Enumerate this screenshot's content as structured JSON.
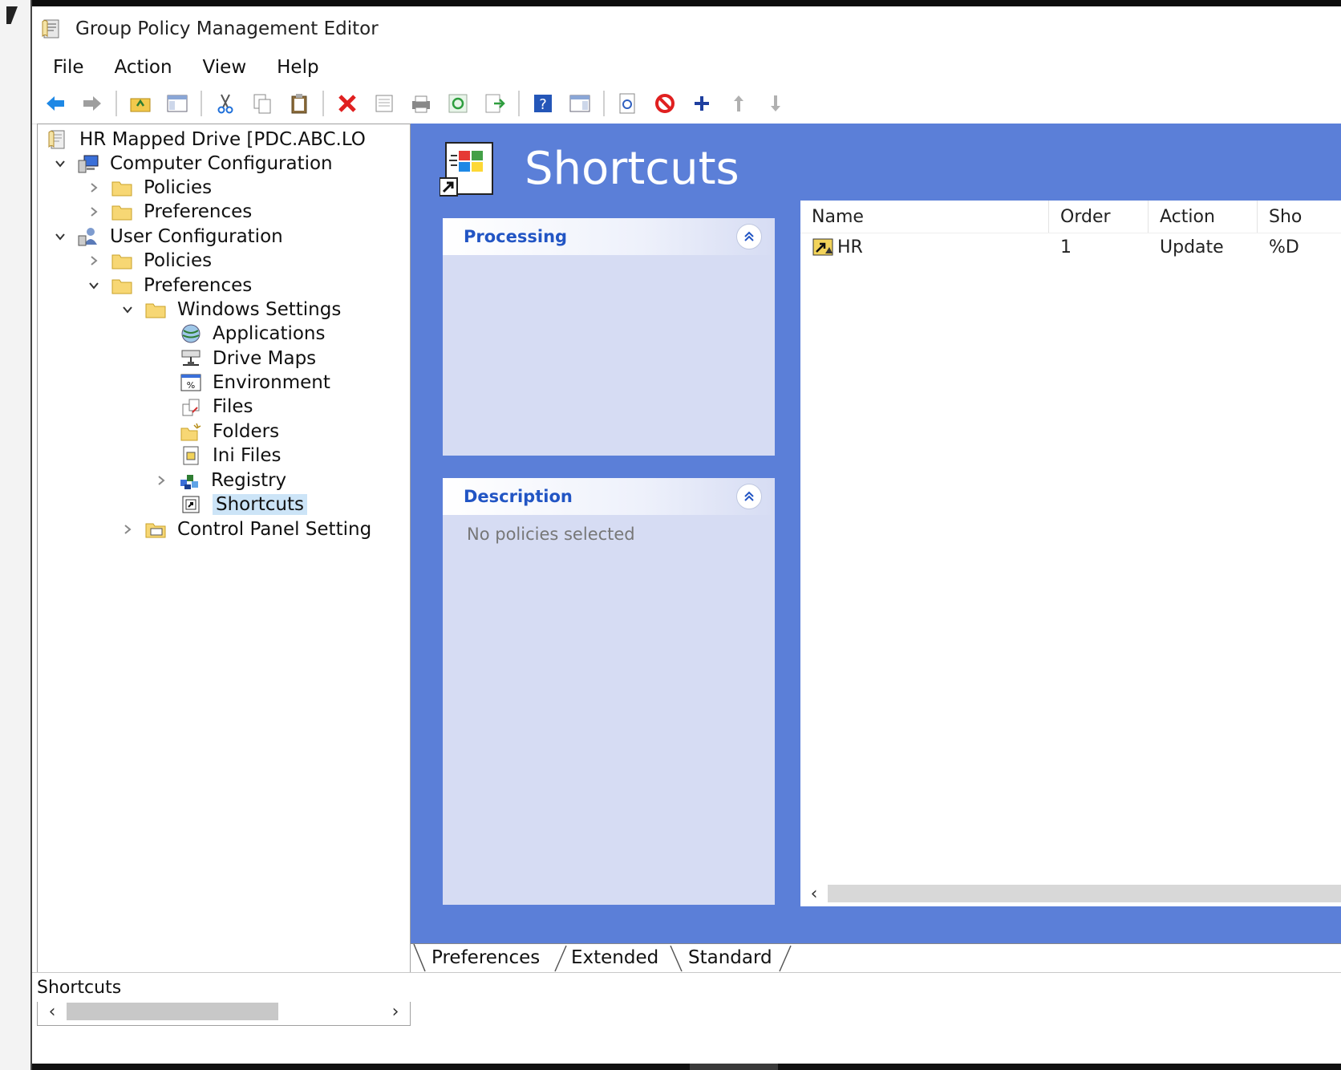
{
  "window": {
    "title": "Group Policy Management Editor",
    "app_icon": "gpo-editor-icon"
  },
  "menu": {
    "items": [
      "File",
      "Action",
      "View",
      "Help"
    ]
  },
  "toolbar": {
    "buttons": [
      "back-arrow-icon",
      "forward-arrow-icon",
      "up-folder-icon",
      "show-hide-tree-icon",
      "cut-icon",
      "copy-icon",
      "paste-icon",
      "delete-icon",
      "properties-icon",
      "print-icon",
      "refresh-icon",
      "export-list-icon",
      "help-icon",
      "show-hide-action-pane-icon",
      "preview-icon",
      "disable-icon",
      "add-icon",
      "move-up-icon",
      "move-down-icon"
    ]
  },
  "tree": {
    "nodes": [
      {
        "label": "HR Mapped Drive [PDC.ABC.LO",
        "icon": "policy-doc-icon"
      },
      {
        "label": "Computer Configuration",
        "icon": "computer-config-icon",
        "expander": "expanded"
      },
      {
        "label": "Policies",
        "icon": "folder-icon",
        "expander": "collapsed"
      },
      {
        "label": "Preferences",
        "icon": "folder-icon",
        "expander": "collapsed"
      },
      {
        "label": "User Configuration",
        "icon": "user-config-icon",
        "expander": "expanded"
      },
      {
        "label": "Policies",
        "icon": "folder-icon",
        "expander": "collapsed"
      },
      {
        "label": "Preferences",
        "icon": "folder-icon",
        "expander": "expanded"
      },
      {
        "label": "Windows Settings",
        "icon": "folder-icon",
        "expander": "expanded"
      },
      {
        "label": "Applications",
        "icon": "applications-icon"
      },
      {
        "label": "Drive Maps",
        "icon": "drive-maps-icon"
      },
      {
        "label": "Environment",
        "icon": "environment-icon"
      },
      {
        "label": "Files",
        "icon": "files-icon"
      },
      {
        "label": "Folders",
        "icon": "folders-icon"
      },
      {
        "label": "Ini Files",
        "icon": "ini-files-icon"
      },
      {
        "label": "Registry",
        "icon": "registry-icon",
        "expander": "collapsed"
      },
      {
        "label": "Shortcuts",
        "icon": "shortcuts-icon",
        "selected": true
      },
      {
        "label": "Control Panel Setting",
        "icon": "control-panel-icon",
        "expander": "collapsed"
      }
    ]
  },
  "content": {
    "title": "Shortcuts",
    "background": "#5b7fd8",
    "panels": {
      "processing": {
        "title": "Processing",
        "text": ""
      },
      "description": {
        "title": "Description",
        "text": "No policies selected"
      }
    },
    "list": {
      "columns": [
        "Name",
        "Order",
        "Action",
        "Sho"
      ],
      "rows": [
        {
          "name": "HR",
          "order": "1",
          "action": "Update",
          "target": "%D",
          "icon": "shortcut-item-icon"
        }
      ]
    }
  },
  "tabs": {
    "items": [
      "Preferences",
      "Extended",
      "Standard"
    ],
    "active": "Preferences"
  },
  "status": {
    "text": "Shortcuts"
  },
  "colors": {
    "accent": "#2255c4",
    "panel_bg": "#d6dcf3",
    "selection": "#cce4f7"
  }
}
